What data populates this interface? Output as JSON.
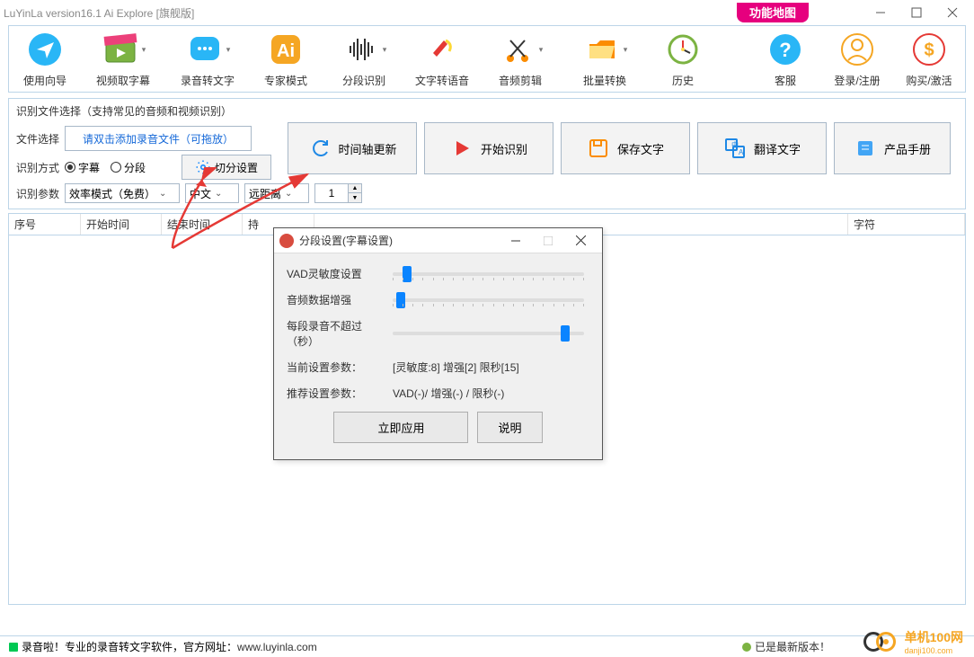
{
  "window_title": "LuYinLa version16.1 Ai Explore [旗舰版]",
  "feature_map_label": "功能地图",
  "toolbar": {
    "guide": "使用向导",
    "video_caption": "视频取字幕",
    "audio2text": "录音转文字",
    "expert": "专家模式",
    "segment": "分段识别",
    "tts": "文字转语音",
    "audio_cut": "音频剪辑",
    "batch": "批量转换",
    "history": "历史",
    "service": "客服",
    "login": "登录/注册",
    "buy": "购买/激活"
  },
  "panel": {
    "hint": "识别文件选择（支持常见的音频和视频识别）",
    "file_label": "文件选择",
    "file_placeholder": "请双击添加录音文件（可拖放）",
    "mode_label": "识别方式",
    "mode_subtitle": "字幕",
    "mode_segment": "分段",
    "cut_settings": "切分设置",
    "param_label": "识别参数",
    "efficiency": "效率模式（免费）",
    "language": "中文",
    "distance": "远距离",
    "num": "1"
  },
  "actions": {
    "timeline": "时间轴更新",
    "start": "开始识别",
    "save": "保存文字",
    "translate": "翻译文字",
    "manual": "产品手册"
  },
  "grid": {
    "seq": "序号",
    "start": "开始时间",
    "end": "结束时间",
    "dur": "持",
    "chars": "字符"
  },
  "dialog": {
    "title": "分段设置(字幕设置)",
    "vad": "VAD灵敏度设置",
    "enhance": "音频数据增强",
    "maxsec": "每段录音不超过（秒）",
    "current_label": "当前设置参数：",
    "current_value": "[灵敏度:8] 增强[2] 限秒[15]",
    "recommend_label": "推荐设置参数：",
    "recommend_value": "VAD(-)/ 增强(-) / 限秒(-)",
    "apply": "立即应用",
    "help": "说明"
  },
  "status": {
    "brand": "录音啦！",
    "desc": "专业的录音转文字软件，官方网址：",
    "url": "www.luyinla.com",
    "latest": "已是最新版本！"
  },
  "watermark": {
    "name": "单机100网",
    "url": "danji100.com"
  }
}
